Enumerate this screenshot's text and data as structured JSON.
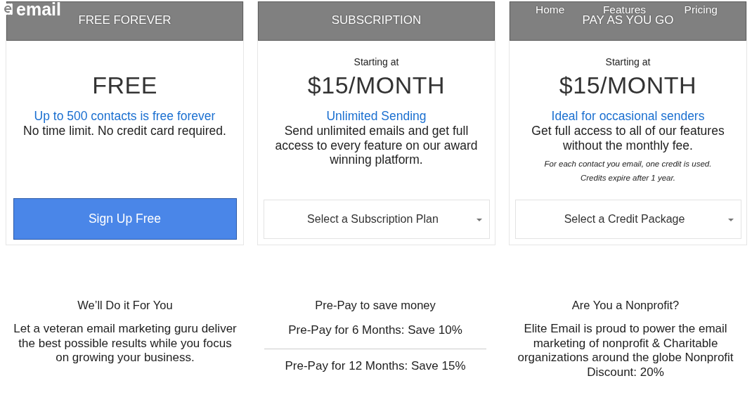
{
  "logo": {
    "text": "email"
  },
  "nav": [
    {
      "label": "Home"
    },
    {
      "label": "Features"
    },
    {
      "label": "Pricing"
    }
  ],
  "plans": [
    {
      "title": "FREE FOREVER",
      "price": "FREE",
      "highlight": "Up to 500 contacts is free forever",
      "description": "No time limit. No credit card required.",
      "action": {
        "kind": "button",
        "label": "Sign Up Free"
      }
    },
    {
      "title": "SUBSCRIPTION",
      "starting": "Starting at",
      "price": "$15/MONTH",
      "highlight": "Unlimited Sending",
      "description": "Send unlimited emails and get full access to every feature on our award winning platform.",
      "action": {
        "kind": "select",
        "label": "Select a Subscription Plan"
      }
    },
    {
      "title": "PAY AS YOU GO",
      "starting": "Starting at",
      "price": "$15/MONTH",
      "highlight": "Ideal for occasional senders",
      "description": "Get full access to all of our features without the monthly fee.",
      "notes": [
        "For each contact you email, one credit is used.",
        "Credits expire after 1 year."
      ],
      "action": {
        "kind": "select",
        "label": "Select a Credit Package"
      }
    }
  ],
  "extras": [
    {
      "kind": "text",
      "title": "We’ll Do it For You",
      "body": "Let a veteran email marketing guru deliver the best possible results while you focus on growing your business."
    },
    {
      "kind": "options",
      "title": "Pre-Pay to save money",
      "options": [
        "Pre-Pay for 6 Months: Save 10%",
        "Pre-Pay for 12 Months: Save 15%"
      ]
    },
    {
      "kind": "text",
      "title": "Are You a Nonprofit?",
      "body": "Elite Email is proud to power the email marketing of nonprofit & Charitable organizations around the globe Nonprofit Discount: 20%"
    }
  ]
}
